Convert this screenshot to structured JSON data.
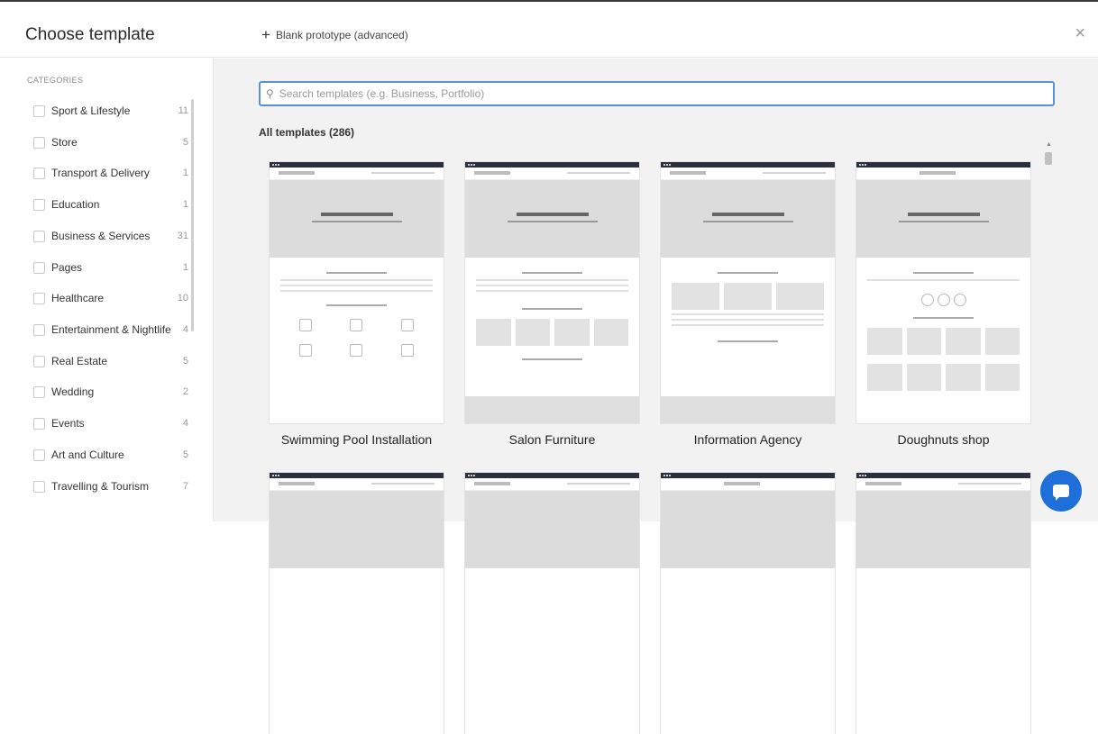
{
  "header": {
    "title": "Choose template",
    "blank_label": "Blank prototype (advanced)",
    "plus_icon": "+",
    "close_icon": "×"
  },
  "sidebar": {
    "heading": "CATEGORIES",
    "categories": [
      {
        "label": "Sport & Lifestyle",
        "count": "11"
      },
      {
        "label": "Store",
        "count": "5"
      },
      {
        "label": "Transport & Delivery",
        "count": "1"
      },
      {
        "label": "Education",
        "count": "1"
      },
      {
        "label": "Business & Services",
        "count": "31"
      },
      {
        "label": "Pages",
        "count": "1"
      },
      {
        "label": "Healthcare",
        "count": "10"
      },
      {
        "label": "Entertainment & Nightlife",
        "count": "4"
      },
      {
        "label": "Real Estate",
        "count": "5"
      },
      {
        "label": "Wedding",
        "count": "2"
      },
      {
        "label": "Events",
        "count": "4"
      },
      {
        "label": "Art and Culture",
        "count": "5"
      },
      {
        "label": "Travelling & Tourism",
        "count": "7"
      }
    ]
  },
  "search": {
    "placeholder": "Search templates (e.g. Business, Portfolio)",
    "value": ""
  },
  "templates": {
    "heading": "All templates (286)",
    "items": [
      {
        "name": "Swimming Pool Installation"
      },
      {
        "name": "Salon Furniture"
      },
      {
        "name": "Information Agency"
      },
      {
        "name": "Doughnuts shop"
      }
    ]
  },
  "colors": {
    "accent": "#1e6fd9",
    "search_border": "#5b8fd6",
    "card_topbar": "#2a3040"
  }
}
